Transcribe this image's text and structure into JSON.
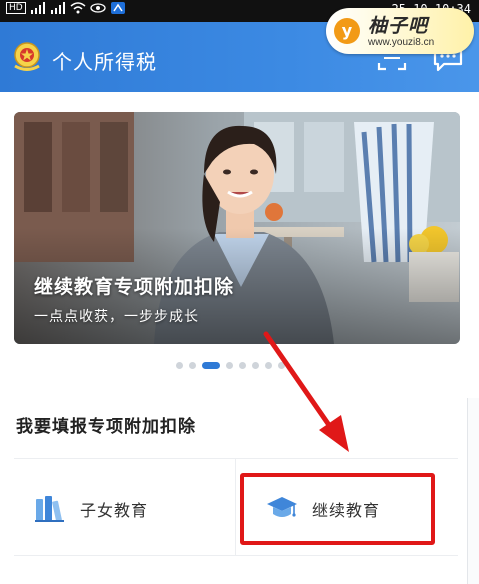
{
  "status_bar": {
    "hd_label": "HD",
    "time": "10:34",
    "date_fragment": "25 10"
  },
  "watermark": {
    "logo_letter": "y",
    "name": "柚子吧",
    "url": "www.youzi8.cn"
  },
  "header": {
    "title": "个人所得税",
    "emblem_icon": "tax-emblem-icon",
    "scan_icon": "scan-icon",
    "message_icon": "message-icon",
    "background": "#3280dc"
  },
  "banner": {
    "title": "继续教育专项附加扣除",
    "subtitle": "一点点收获，一步步成长",
    "slide_count": 8,
    "active_slide": 3
  },
  "section": {
    "title": "我要填报专项附加扣除"
  },
  "items": [
    {
      "label": "子女教育",
      "icon": "books-icon"
    },
    {
      "label": "继续教育",
      "icon": "graduation-cap-icon"
    }
  ],
  "annotation": {
    "color": "#e01818",
    "highlighted_item": "继续教育"
  }
}
